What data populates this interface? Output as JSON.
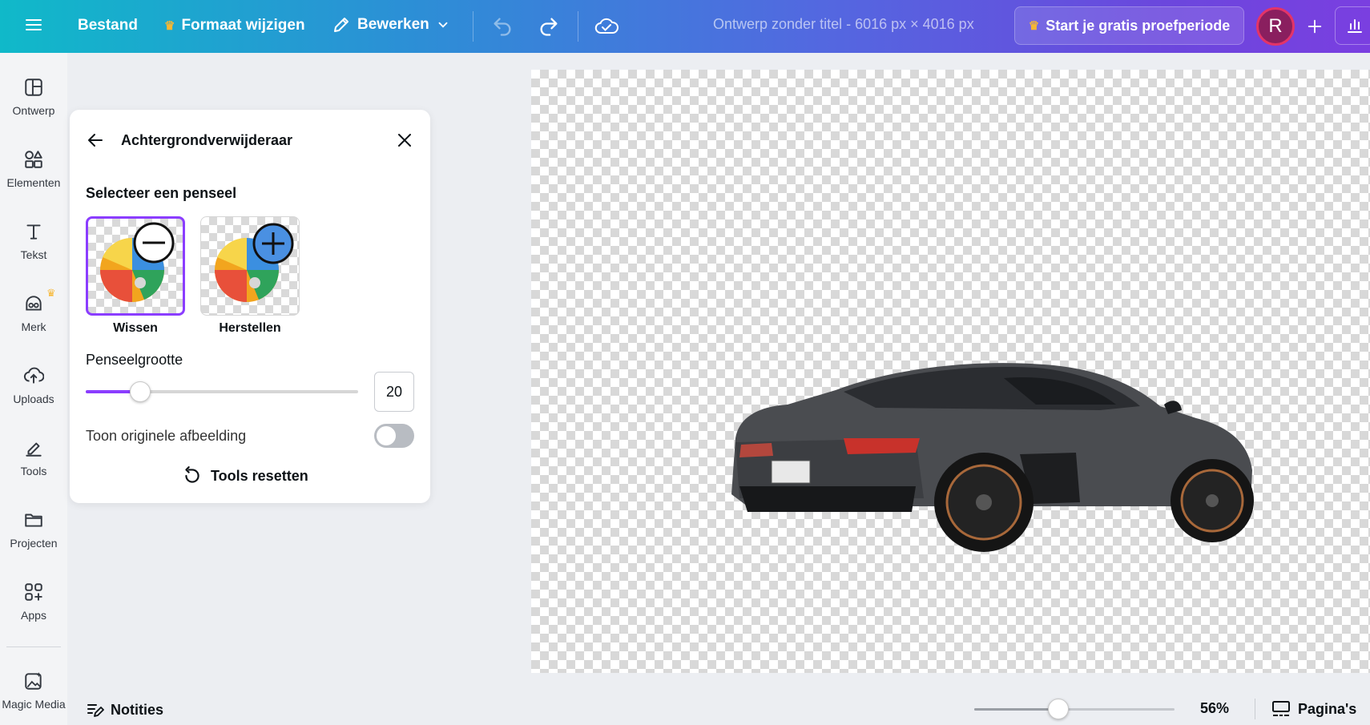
{
  "topbar": {
    "menu_icon": "hamburger-icon",
    "file_label": "Bestand",
    "resize_label": "Formaat wijzigen",
    "edit_label": "Bewerken",
    "doc_title": "Ontwerp zonder titel - 6016 px × 4016 px",
    "trial_label": "Start je gratis proefperiode",
    "avatar_initial": "R",
    "accent_color": "#8b3dff"
  },
  "rail": {
    "items": [
      {
        "label": "Ontwerp",
        "icon": "layout-icon"
      },
      {
        "label": "Elementen",
        "icon": "shapes-icon"
      },
      {
        "label": "Tekst",
        "icon": "text-icon"
      },
      {
        "label": "Merk",
        "icon": "brand-icon"
      },
      {
        "label": "Uploads",
        "icon": "cloud-upload-icon"
      },
      {
        "label": "Tools",
        "icon": "pen-tool-icon"
      },
      {
        "label": "Projecten",
        "icon": "folder-icon"
      },
      {
        "label": "Apps",
        "icon": "apps-grid-icon"
      },
      {
        "label": "Magic Media",
        "icon": "magic-image-icon"
      }
    ]
  },
  "panel": {
    "title": "Achtergrondverwijderaar",
    "brush_section": "Selecteer een penseel",
    "brushes": [
      {
        "label": "Wissen",
        "selected": true
      },
      {
        "label": "Herstellen",
        "selected": false
      }
    ],
    "size_label": "Penseelgrootte",
    "size_value": "20",
    "size_fraction": 0.2,
    "toggle_label": "Toon originele afbeelding",
    "toggle_on": false,
    "reset_label": "Tools resetten"
  },
  "bottombar": {
    "notes_label": "Notities",
    "zoom_value": "56%",
    "zoom_fraction": 0.42,
    "pages_label": "Pagina's"
  }
}
